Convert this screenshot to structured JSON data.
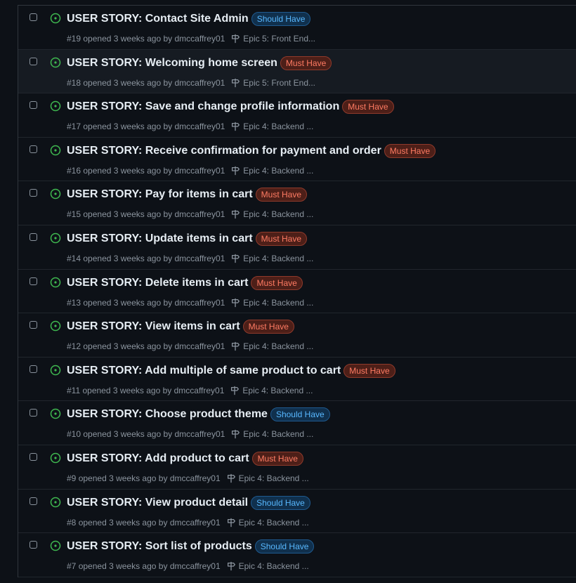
{
  "colors": {
    "background": "#0d1117",
    "open_icon": "#3fb950",
    "must_have_text": "#ff7b63",
    "should_have_text": "#58b8ff"
  },
  "icons": {
    "state": "issue-opened-icon",
    "milestone": "milestone-icon"
  },
  "issues": [
    {
      "title": "USER STORY: Contact Site Admin",
      "label": "Should Have",
      "label_type": "should",
      "number": "#19",
      "opened_text": "opened 3 weeks ago by",
      "author": "dmccaffrey01",
      "milestone": "Epic 5: Front End..."
    },
    {
      "title": "USER STORY: Welcoming home screen",
      "label": "Must Have",
      "label_type": "must",
      "number": "#18",
      "opened_text": "opened 3 weeks ago by",
      "author": "dmccaffrey01",
      "milestone": "Epic 5: Front End..."
    },
    {
      "title": "USER STORY: Save and change profile information",
      "label": "Must Have",
      "label_type": "must",
      "number": "#17",
      "opened_text": "opened 3 weeks ago by",
      "author": "dmccaffrey01",
      "milestone": "Epic 4: Backend ..."
    },
    {
      "title": "USER STORY: Receive confirmation for payment and order",
      "label": "Must Have",
      "label_type": "must",
      "number": "#16",
      "opened_text": "opened 3 weeks ago by",
      "author": "dmccaffrey01",
      "milestone": "Epic 4: Backend ..."
    },
    {
      "title": "USER STORY: Pay for items in cart",
      "label": "Must Have",
      "label_type": "must",
      "number": "#15",
      "opened_text": "opened 3 weeks ago by",
      "author": "dmccaffrey01",
      "milestone": "Epic 4: Backend ..."
    },
    {
      "title": "USER STORY: Update items in cart",
      "label": "Must Have",
      "label_type": "must",
      "number": "#14",
      "opened_text": "opened 3 weeks ago by",
      "author": "dmccaffrey01",
      "milestone": "Epic 4: Backend ..."
    },
    {
      "title": "USER STORY: Delete items in cart",
      "label": "Must Have",
      "label_type": "must",
      "number": "#13",
      "opened_text": "opened 3 weeks ago by",
      "author": "dmccaffrey01",
      "milestone": "Epic 4: Backend ..."
    },
    {
      "title": "USER STORY: View items in cart",
      "label": "Must Have",
      "label_type": "must",
      "number": "#12",
      "opened_text": "opened 3 weeks ago by",
      "author": "dmccaffrey01",
      "milestone": "Epic 4: Backend ..."
    },
    {
      "title": "USER STORY: Add multiple of same product to cart",
      "label": "Must Have",
      "label_type": "must",
      "number": "#11",
      "opened_text": "opened 3 weeks ago by",
      "author": "dmccaffrey01",
      "milestone": "Epic 4: Backend ..."
    },
    {
      "title": "USER STORY: Choose product theme",
      "label": "Should Have",
      "label_type": "should",
      "number": "#10",
      "opened_text": "opened 3 weeks ago by",
      "author": "dmccaffrey01",
      "milestone": "Epic 4: Backend ..."
    },
    {
      "title": "USER STORY: Add product to cart",
      "label": "Must Have",
      "label_type": "must",
      "number": "#9",
      "opened_text": "opened 3 weeks ago by",
      "author": "dmccaffrey01",
      "milestone": "Epic 4: Backend ..."
    },
    {
      "title": "USER STORY: View product detail",
      "label": "Should Have",
      "label_type": "should",
      "number": "#8",
      "opened_text": "opened 3 weeks ago by",
      "author": "dmccaffrey01",
      "milestone": "Epic 4: Backend ..."
    },
    {
      "title": "USER STORY: Sort list of products",
      "label": "Should Have",
      "label_type": "should",
      "number": "#7",
      "opened_text": "opened 3 weeks ago by",
      "author": "dmccaffrey01",
      "milestone": "Epic 4: Backend ..."
    }
  ]
}
